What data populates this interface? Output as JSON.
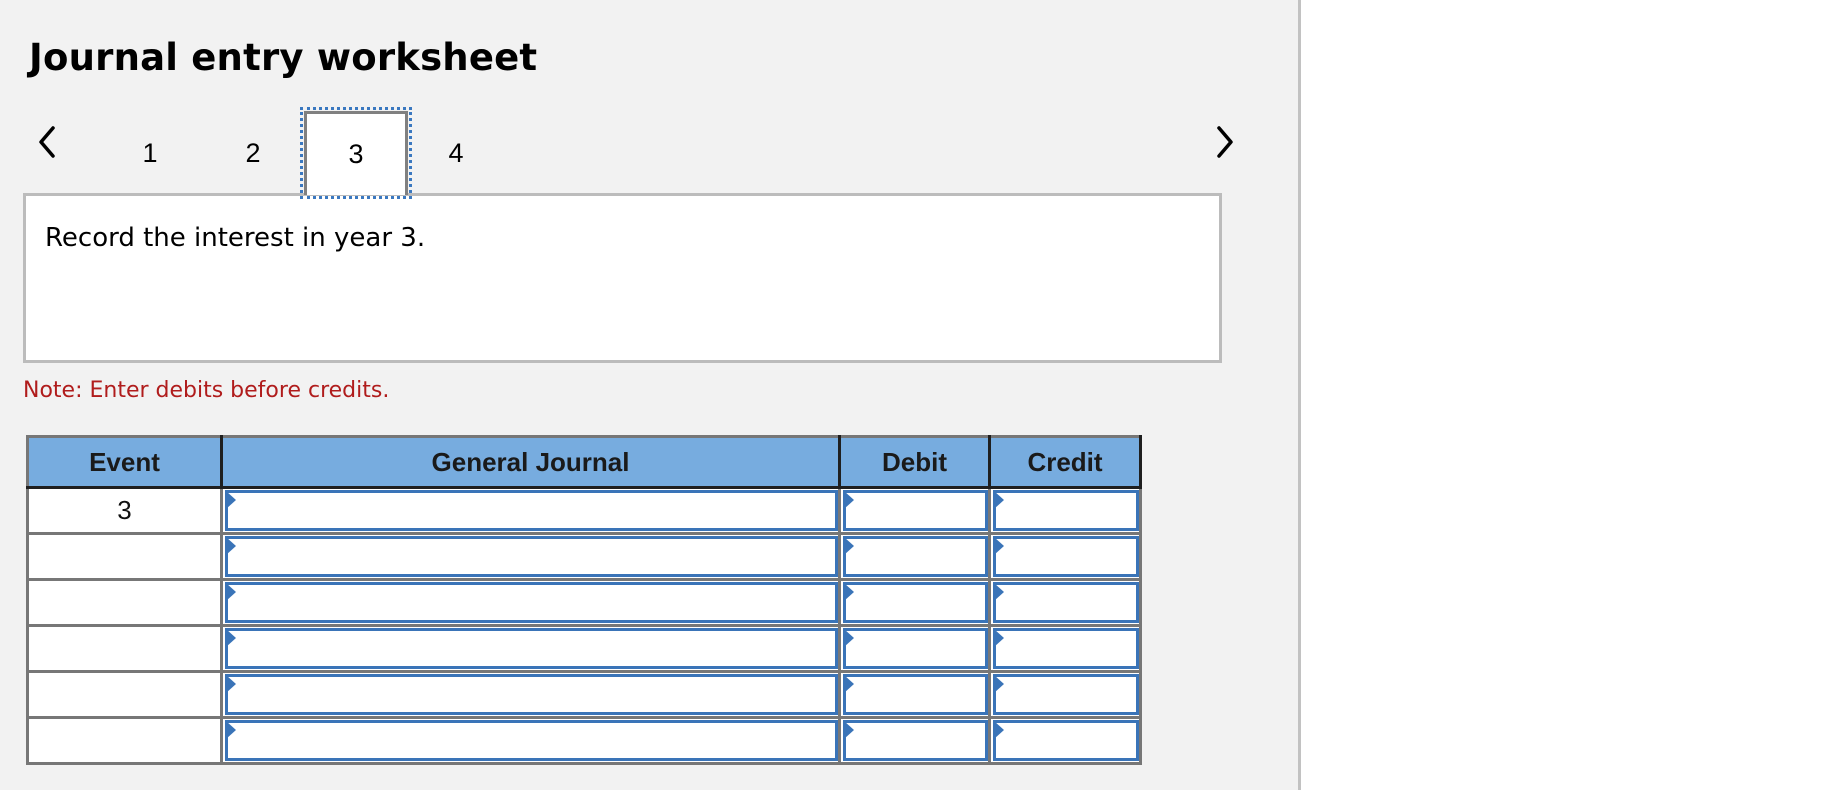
{
  "worksheet": {
    "title": "Journal entry worksheet",
    "nav": {
      "prev_icon": "chevron-left-icon",
      "next_icon": "chevron-right-icon",
      "tabs": [
        {
          "label": "1",
          "active": false
        },
        {
          "label": "2",
          "active": false
        },
        {
          "label": "3",
          "active": true
        },
        {
          "label": "4",
          "active": false
        }
      ]
    },
    "instruction": "Record the interest in year 3.",
    "note": "Note: Enter debits before credits.",
    "colors": {
      "header_bg": "#77acdf",
      "input_border": "#3a74b8",
      "note_text": "#b01c1c",
      "active_tab_outline": "#3a78c0"
    },
    "table": {
      "headers": {
        "event": "Event",
        "general_journal": "General Journal",
        "debit": "Debit",
        "credit": "Credit"
      },
      "rows": [
        {
          "event": "3",
          "general_journal": "",
          "debit": "",
          "credit": ""
        },
        {
          "event": "",
          "general_journal": "",
          "debit": "",
          "credit": ""
        },
        {
          "event": "",
          "general_journal": "",
          "debit": "",
          "credit": ""
        },
        {
          "event": "",
          "general_journal": "",
          "debit": "",
          "credit": ""
        },
        {
          "event": "",
          "general_journal": "",
          "debit": "",
          "credit": ""
        },
        {
          "event": "",
          "general_journal": "",
          "debit": "",
          "credit": ""
        }
      ]
    }
  }
}
